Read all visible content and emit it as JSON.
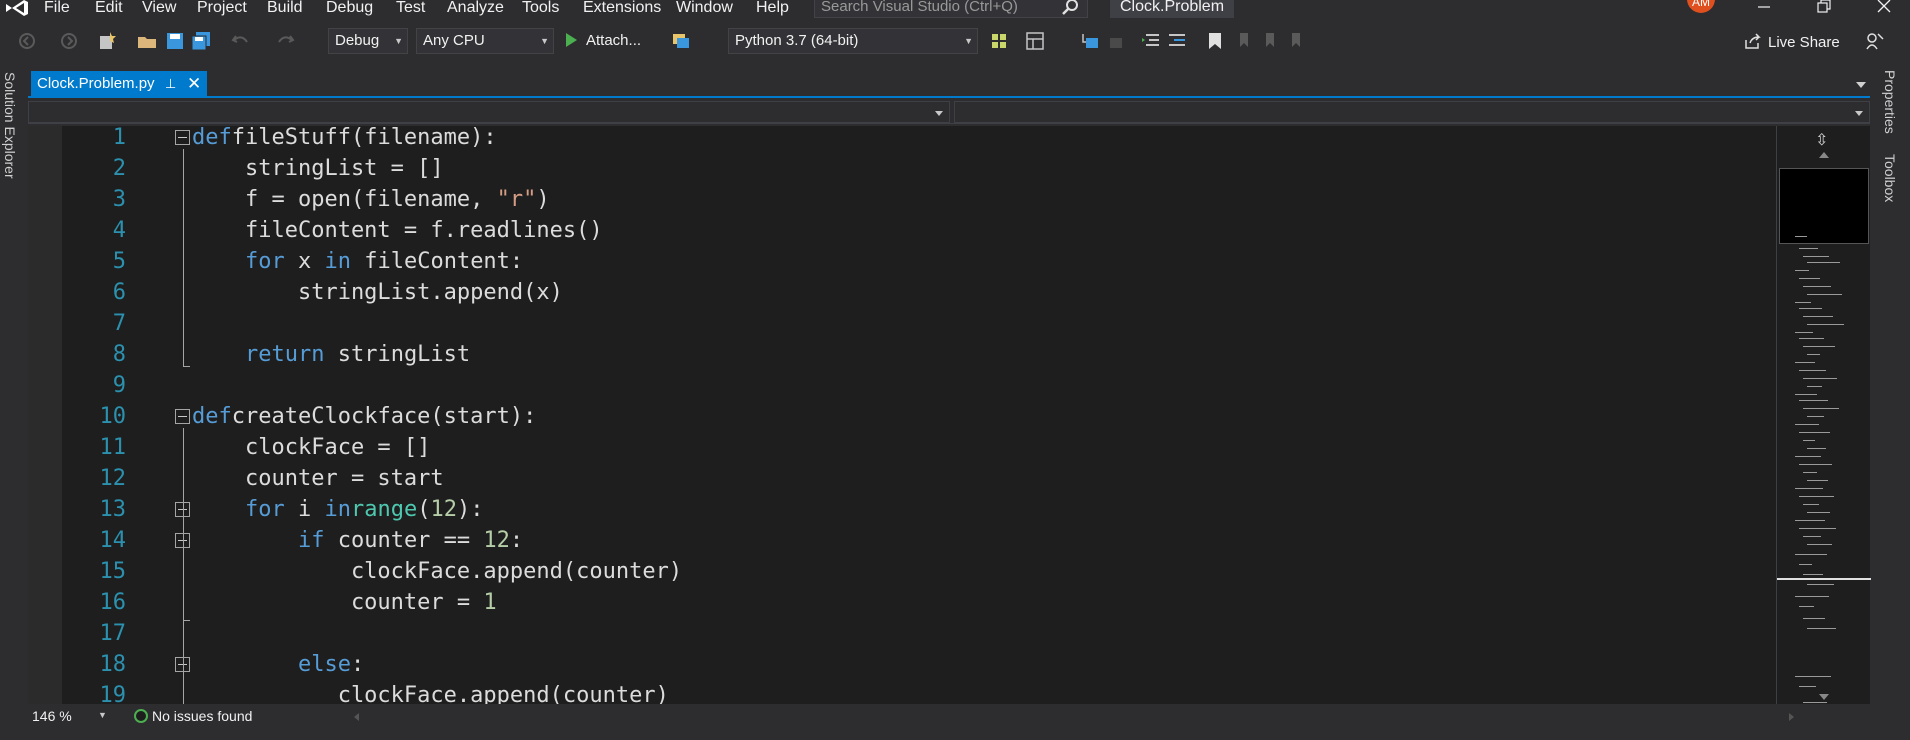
{
  "menu": {
    "items": [
      "File",
      "Edit",
      "View",
      "Project",
      "Build",
      "Debug",
      "Test",
      "Analyze",
      "Tools",
      "Extensions",
      "Window",
      "Help"
    ],
    "search_placeholder": "Search Visual Studio (Ctrl+Q)",
    "window_title": "Clock.Problem",
    "avatar_initials": "AM"
  },
  "toolbar": {
    "configuration": "Debug",
    "platform": "Any CPU",
    "attach_label": "Attach...",
    "environment": "Python 3.7 (64-bit)",
    "live_share_label": "Live Share"
  },
  "side_panels": {
    "left": "Solution Explorer",
    "right_top": "Properties",
    "right_bottom": "Toolbox"
  },
  "tab": {
    "filename": "Clock.Problem.py",
    "pin_glyph": "⊥",
    "close_glyph": "✕"
  },
  "editor": {
    "lines": [
      {
        "n": "1",
        "tokens": [
          [
            "kw",
            "def"
          ],
          [
            "",
            "fileStuff(filename):"
          ]
        ]
      },
      {
        "n": "2",
        "tokens": [
          [
            "",
            "    stringList = []"
          ]
        ]
      },
      {
        "n": "3",
        "tokens": [
          [
            "",
            "    f = open(filename, "
          ],
          [
            "str",
            "\"r\""
          ],
          [
            "",
            ")"
          ]
        ]
      },
      {
        "n": "4",
        "tokens": [
          [
            "",
            "    fileContent = f.readlines()"
          ]
        ]
      },
      {
        "n": "5",
        "tokens": [
          [
            "",
            "    "
          ],
          [
            "kw",
            "for"
          ],
          [
            "",
            " x "
          ],
          [
            "kw",
            "in"
          ],
          [
            "",
            " fileContent:"
          ]
        ]
      },
      {
        "n": "6",
        "tokens": [
          [
            "",
            "        stringList.append(x)"
          ]
        ]
      },
      {
        "n": "7",
        "tokens": [
          [
            "",
            ""
          ]
        ]
      },
      {
        "n": "8",
        "tokens": [
          [
            "",
            "    "
          ],
          [
            "kw",
            "return"
          ],
          [
            "",
            " stringList"
          ]
        ]
      },
      {
        "n": "9",
        "tokens": [
          [
            "",
            ""
          ]
        ]
      },
      {
        "n": "10",
        "tokens": [
          [
            "kw",
            "def"
          ],
          [
            "",
            "createClockface(start):"
          ]
        ]
      },
      {
        "n": "11",
        "tokens": [
          [
            "",
            "    clockFace = []"
          ]
        ]
      },
      {
        "n": "12",
        "tokens": [
          [
            "",
            "    counter = start"
          ]
        ]
      },
      {
        "n": "13",
        "tokens": [
          [
            "",
            "    "
          ],
          [
            "kw",
            "for"
          ],
          [
            "",
            " i "
          ],
          [
            "kw",
            "in"
          ],
          [
            " ",
            ""
          ],
          [
            "bi",
            "range"
          ],
          [
            "",
            "("
          ],
          [
            "num-lit",
            "12"
          ],
          [
            "",
            "):"
          ]
        ]
      },
      {
        "n": "14",
        "tokens": [
          [
            "",
            "        "
          ],
          [
            "kw",
            "if"
          ],
          [
            "",
            " counter == "
          ],
          [
            "num-lit",
            "12"
          ],
          [
            "",
            ":"
          ]
        ]
      },
      {
        "n": "15",
        "tokens": [
          [
            "",
            "            clockFace.append(counter)"
          ]
        ]
      },
      {
        "n": "16",
        "tokens": [
          [
            "",
            "            counter = "
          ],
          [
            "num-lit",
            "1"
          ]
        ]
      },
      {
        "n": "17",
        "tokens": [
          [
            "",
            ""
          ]
        ]
      },
      {
        "n": "18",
        "tokens": [
          [
            "",
            "        "
          ],
          [
            "kw",
            "else"
          ],
          [
            "",
            ":"
          ]
        ]
      },
      {
        "n": "19",
        "tokens": [
          [
            "",
            "           clockFace.append(counter)"
          ]
        ]
      }
    ],
    "fold_lines": [
      "1",
      "10",
      "13",
      "14",
      "18"
    ]
  },
  "status": {
    "zoom": "146 %",
    "issues": "No issues found"
  },
  "colors": {
    "accent": "#007acc",
    "keyword": "#569cd6",
    "line_number": "#2b91af",
    "string": "#d69d85",
    "number": "#b5cea8",
    "builtin": "#4ec9b0"
  }
}
